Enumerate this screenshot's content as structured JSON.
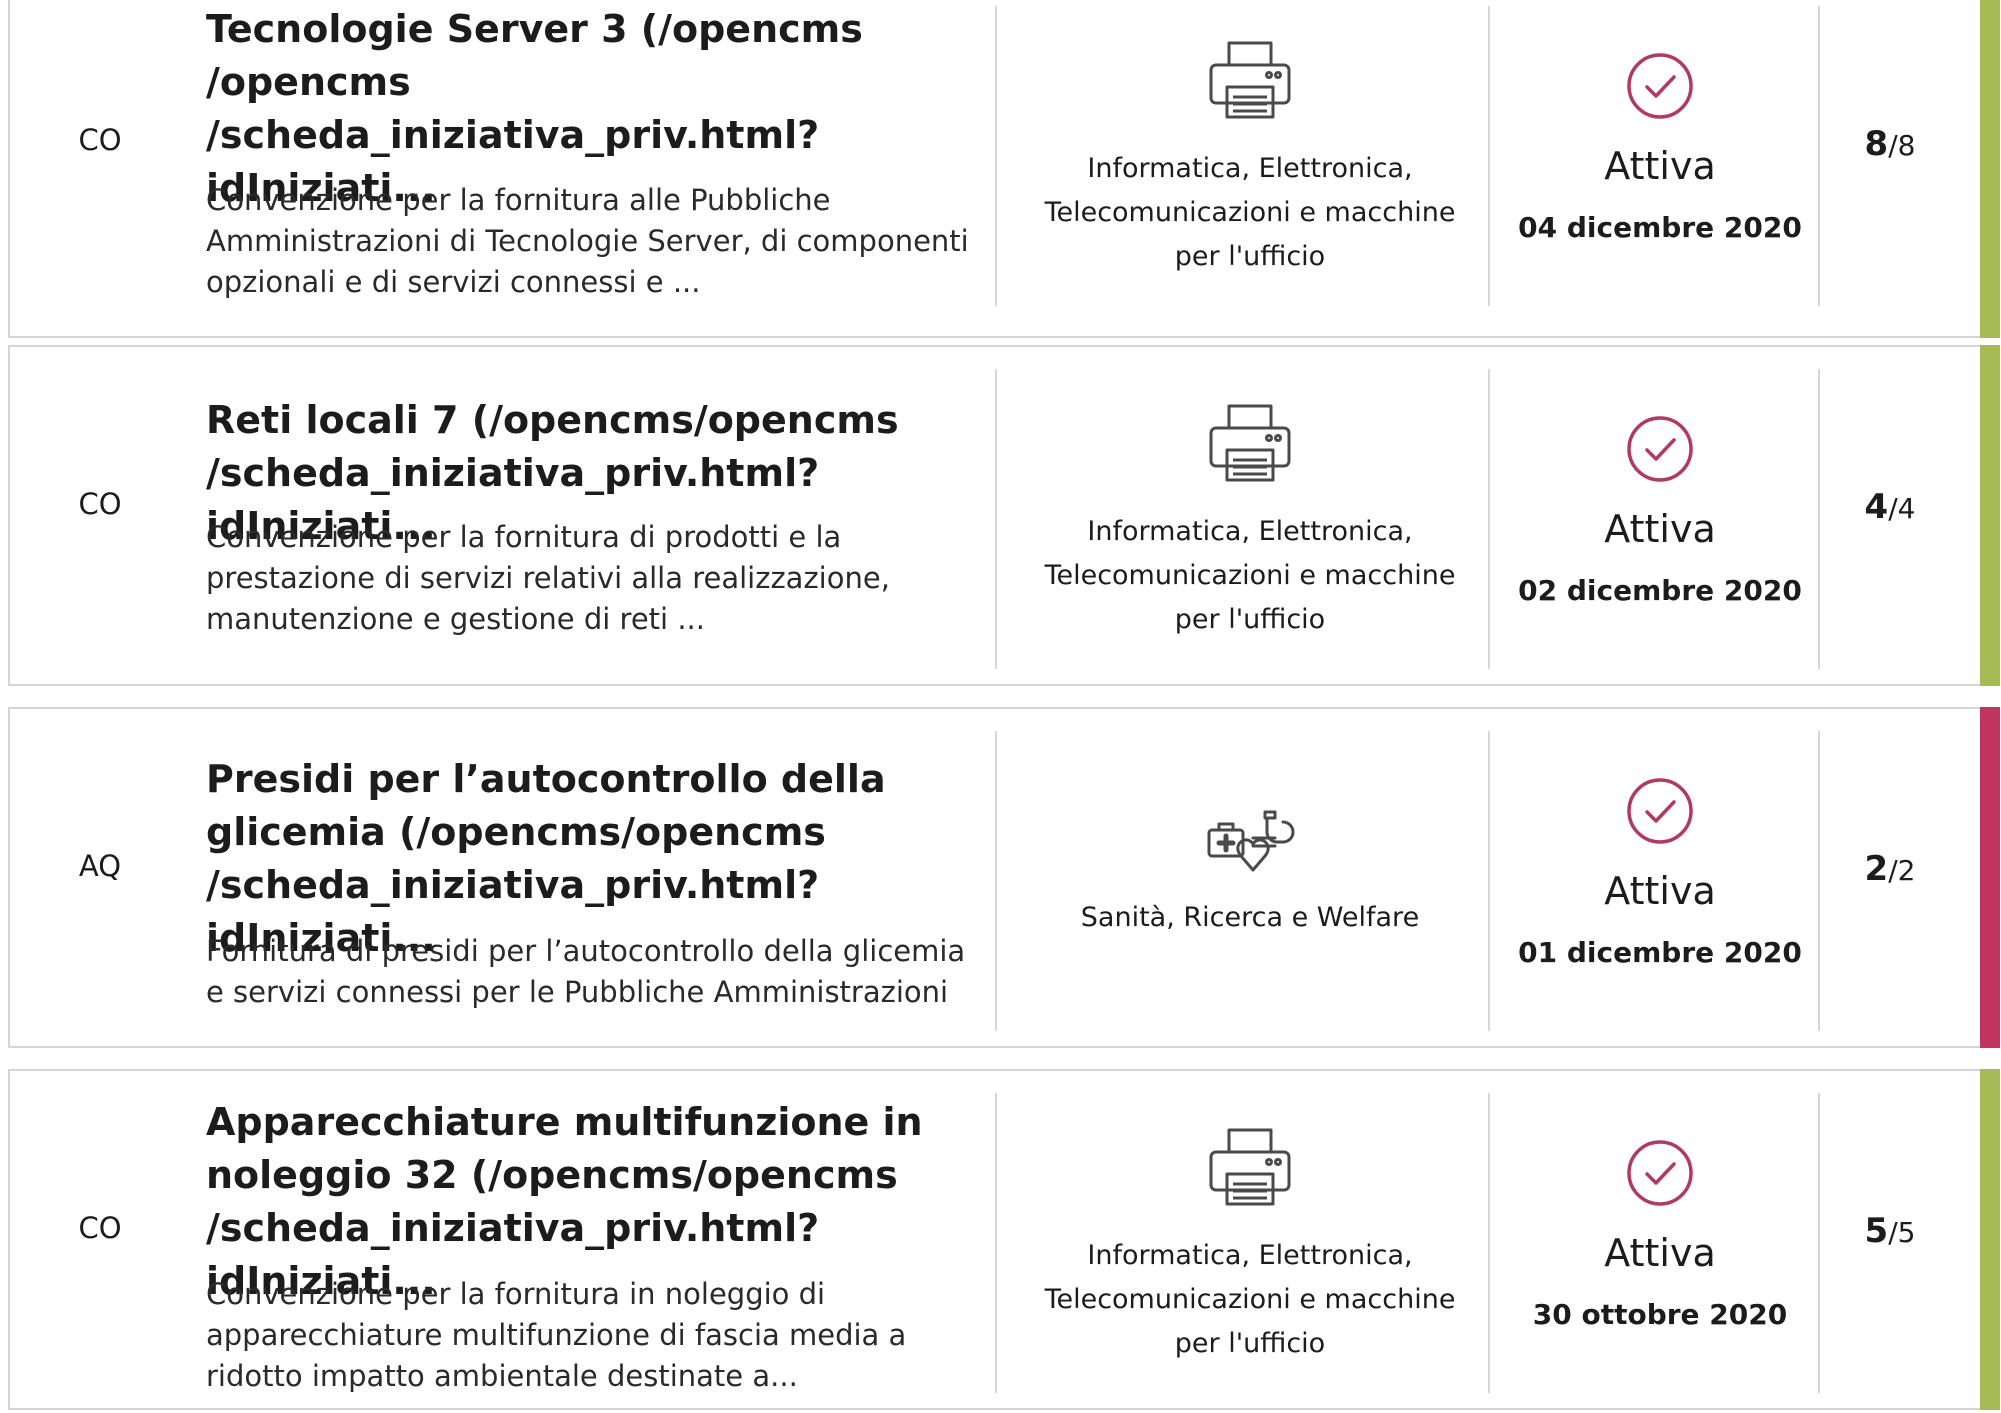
{
  "colors": {
    "accent_green": "#a6bb56",
    "accent_red": "#c2345f",
    "status_icon": "#b03a61",
    "border": "#d5d5d5"
  },
  "initiatives": [
    {
      "type": "CO",
      "title_lines": [
        "Tecnologie Server 3  (/opencms",
        "/opencms",
        "/scheda_iniziativa_priv.html?idIniziati..."
      ],
      "description_lines": [
        "Convenzione per la fornitura alle Pubbliche",
        "Amministrazioni di Tecnologie Server, di componenti",
        "opzionali e di servizi connessi e ..."
      ],
      "category_icon": "printer-icon",
      "category_lines": [
        "Informatica, Elettronica,",
        "Telecomunicazioni e macchine",
        "per l'ufficio"
      ],
      "status_icon": "check-circle-icon",
      "status": "Attiva",
      "date": "04 dicembre 2020",
      "count_current": "8",
      "count_total": "/8",
      "accent": "green"
    },
    {
      "type": "CO",
      "title_lines": [
        "Reti locali 7  (/opencms/opencms",
        "/scheda_iniziativa_priv.html?idIniziati..."
      ],
      "description_lines": [
        "Convenzione per la fornitura di prodotti e la",
        "prestazione di servizi relativi alla realizzazione,",
        "manutenzione e gestione di reti ..."
      ],
      "category_icon": "printer-icon",
      "category_lines": [
        "Informatica, Elettronica,",
        "Telecomunicazioni e macchine",
        "per l'ufficio"
      ],
      "status_icon": "check-circle-icon",
      "status": "Attiva",
      "date": "02 dicembre 2020",
      "count_current": "4",
      "count_total": "/4",
      "accent": "green"
    },
    {
      "type": "AQ",
      "title_lines": [
        "Presidi per l’autocontrollo della",
        "glicemia  (/opencms/opencms",
        "/scheda_iniziativa_priv.html?idIniziati..."
      ],
      "description_lines": [
        "Fornitura di presidi per l’autocontrollo della glicemia",
        "e servizi connessi per le Pubbliche Amministrazioni"
      ],
      "category_icon": "health-kit-icon",
      "category_lines": [
        "Sanità, Ricerca e Welfare"
      ],
      "status_icon": "check-circle-icon",
      "status": "Attiva",
      "date": "01 dicembre 2020",
      "count_current": "2",
      "count_total": "/2",
      "accent": "red"
    },
    {
      "type": "CO",
      "title_lines": [
        "Apparecchiature multifunzione in",
        "noleggio 32  (/opencms/opencms",
        "/scheda_iniziativa_priv.html?idIniziati..."
      ],
      "description_lines": [
        "Convenzione per la fornitura in noleggio di",
        "apparecchiature multifunzione di fascia media a",
        "ridotto impatto ambientale destinate a..."
      ],
      "category_icon": "printer-icon",
      "category_lines": [
        "Informatica, Elettronica,",
        "Telecomunicazioni e macchine",
        "per l'ufficio"
      ],
      "status_icon": "check-circle-icon",
      "status": "Attiva",
      "date": "30 ottobre 2020",
      "count_current": "5",
      "count_total": "/5",
      "accent": "green"
    }
  ]
}
